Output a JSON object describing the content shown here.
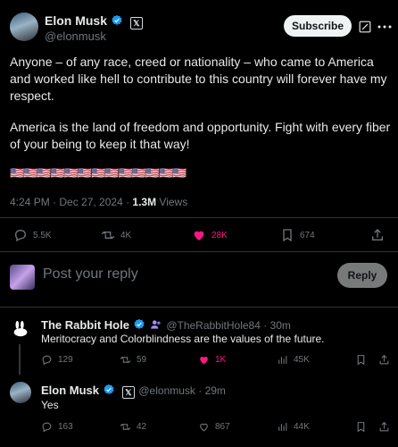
{
  "main_post": {
    "author_name": "Elon Musk",
    "author_handle": "@elonmusk",
    "subscribe_label": "Subscribe",
    "paragraph1": "Anyone – of any race, creed or nationality – who came to America and worked like hell to contribute to this country will forever have my respect.",
    "paragraph2": "America is the land of freedom and opportunity. Fight with every fiber of your being to keep it that way!",
    "flags": "🇺🇸🇺🇸🇺🇸🇺🇸🇺🇸🇺🇸🇺🇸🇺🇸🇺🇸🇺🇸🇺🇸🇺🇸🇺🇸",
    "timestamp": "4:24 PM · Dec 27, 2024 · ",
    "views_count": "1.3M",
    "views_label": " Views",
    "stats": {
      "replies": "5.5K",
      "reposts": "4K",
      "likes": "28K",
      "bookmarks": "674"
    }
  },
  "reply_box": {
    "placeholder": "Post your reply",
    "button_label": "Reply"
  },
  "reply1": {
    "author_name": "The Rabbit Hole",
    "author_handle": "@TheRabbitHole84 · 30m",
    "text": "Meritocracy and Colorblindness are the values of the future.",
    "stats": {
      "replies": "129",
      "reposts": "59",
      "likes": "1K",
      "views": "45K"
    }
  },
  "reply2": {
    "author_name": "Elon Musk",
    "author_handle": "@elonmusk · 29m",
    "text": "Yes",
    "stats": {
      "replies": "163",
      "reposts": "42",
      "likes": "867",
      "views": "44K"
    }
  },
  "colors": {
    "verified_blue": "#1d9bf0",
    "like_pink": "#f91880",
    "gray": "#71767b"
  }
}
